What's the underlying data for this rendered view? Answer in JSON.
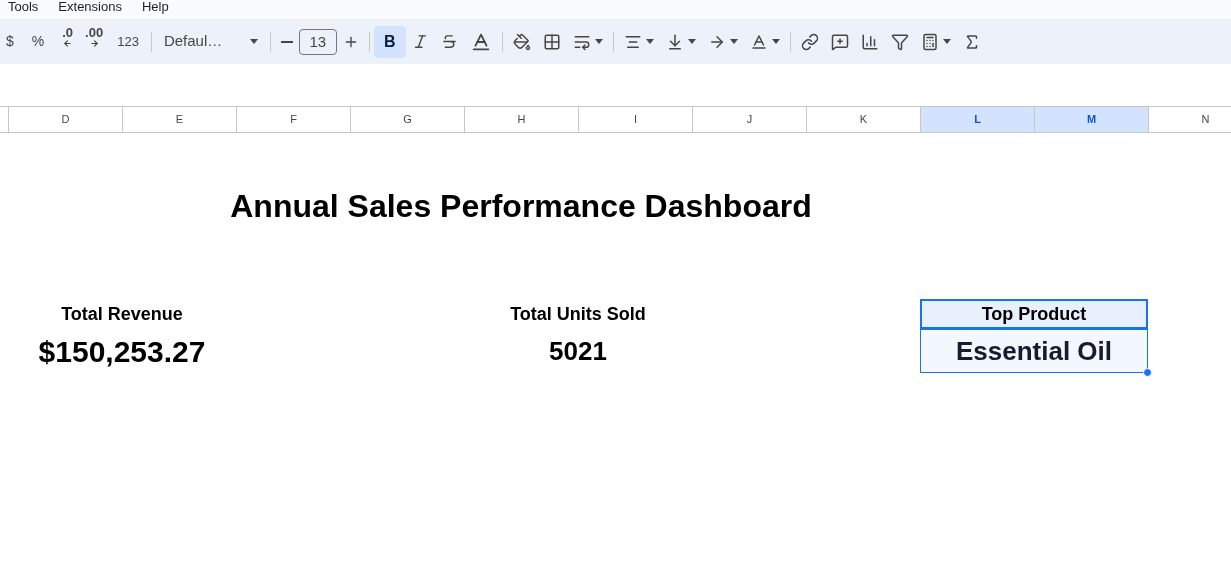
{
  "menu": [
    "Tools",
    "Extensions",
    "Help"
  ],
  "toolbar": {
    "currency": "$",
    "percent": "%",
    "decrease_decimal": ".0",
    "increase_decimal": ".00",
    "number_format": "123",
    "font": "Defaul…",
    "font_size": "13",
    "bold": {
      "label": "B",
      "selected": true
    }
  },
  "columns": [
    {
      "label": "D",
      "selected": false
    },
    {
      "label": "E",
      "selected": false
    },
    {
      "label": "F",
      "selected": false
    },
    {
      "label": "G",
      "selected": false
    },
    {
      "label": "H",
      "selected": false
    },
    {
      "label": "I",
      "selected": false
    },
    {
      "label": "J",
      "selected": false
    },
    {
      "label": "K",
      "selected": false
    },
    {
      "label": "L",
      "selected": true
    },
    {
      "label": "M",
      "selected": true
    },
    {
      "label": "N",
      "selected": false
    }
  ],
  "sheet": {
    "title": "Annual Sales Performance Dashboard",
    "revenue": {
      "label": "Total Revenue",
      "value": "$150,253.27"
    },
    "units": {
      "label": "Total Units Sold",
      "value": "5021"
    },
    "top_product": {
      "label": "Top Product",
      "value": "Essential Oil",
      "selected": true
    }
  }
}
